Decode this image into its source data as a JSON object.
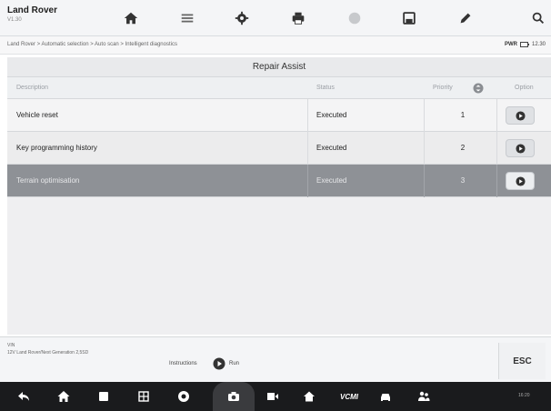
{
  "header": {
    "title": "Land Rover",
    "subtitle": "V1.30",
    "icons": [
      "home-icon",
      "vehicle-swap-icon",
      "settings-icon",
      "print-icon",
      "help-icon",
      "save-icon",
      "edit-icon",
      "search-icon"
    ]
  },
  "breadcrumb": {
    "path": "Land Rover > Automatic selection > Auto scan > Intelligent diagnostics",
    "right_label": "PWR",
    "right_value": "12.30"
  },
  "panel": {
    "title": "Repair Assist",
    "columns": {
      "description": "Description",
      "status": "Status",
      "priority": "Priority",
      "option": "Option"
    },
    "rows": [
      {
        "description": "Vehicle reset",
        "status": "Executed",
        "priority": "1",
        "selected": false
      },
      {
        "description": "Key programming history",
        "status": "Executed",
        "priority": "2",
        "selected": false
      },
      {
        "description": "Terrain optimisation",
        "status": "Executed",
        "priority": "3",
        "selected": true
      }
    ]
  },
  "footer": {
    "vin_label": "VIN",
    "vin_text": "12V Land Rover/Next Generation 2,5SD",
    "instructions_label": "Instructions",
    "run_label": "Run",
    "esc_label": "ESC"
  },
  "navbar": {
    "vcmi_label": "VCMI",
    "status_text": "16:20"
  },
  "colors": {
    "selected_row": "#8e9196",
    "navbar": "#1a1b1d"
  }
}
